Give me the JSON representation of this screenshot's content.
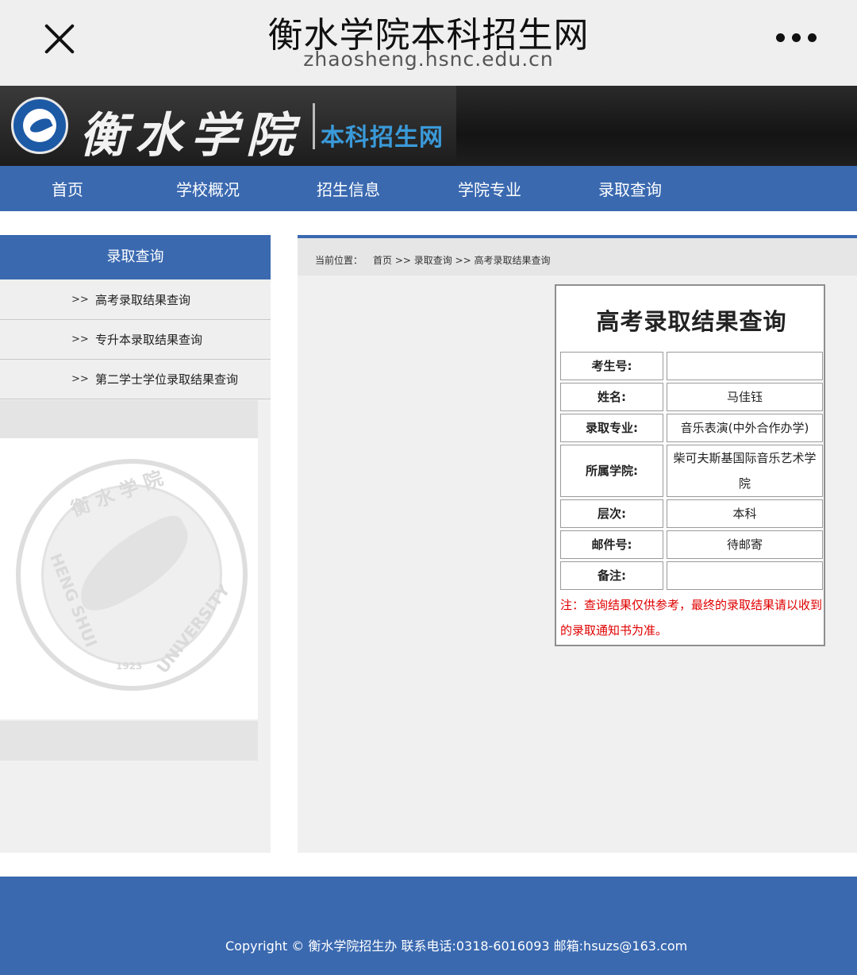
{
  "browser": {
    "title": "衡水学院本科招生网",
    "url": "zhaosheng.hsnc.edu.cn"
  },
  "header": {
    "school_name": "衡水学院",
    "subtitle": "本科招生网"
  },
  "nav": {
    "items": [
      "首页",
      "学校概况",
      "招生信息",
      "学院专业",
      "录取查询"
    ]
  },
  "sidebar": {
    "title": "录取查询",
    "arrow": ">>",
    "items": [
      "高考录取结果查询",
      "专升本录取结果查询",
      "第二学士学位录取结果查询"
    ],
    "watermark": {
      "cn": "衡 水 学 院",
      "en_left": "HENG SHUI",
      "year": "1923",
      "en_right": "UNIVERSITY"
    }
  },
  "breadcrumb": {
    "label": "当前位置：",
    "path": "首页 >> 录取查询 >> 高考录取结果查询"
  },
  "result": {
    "title": "高考录取结果查询",
    "rows": [
      {
        "label": "考生号:",
        "value": ""
      },
      {
        "label": "姓名:",
        "value": "马佳钰"
      },
      {
        "label": "录取专业:",
        "value": "音乐表演(中外合作办学)"
      },
      {
        "label": "所属学院:",
        "value": "柴可夫斯基国际音乐艺术学院"
      },
      {
        "label": "层次:",
        "value": "本科"
      },
      {
        "label": "邮件号:",
        "value": "待邮寄"
      },
      {
        "label": "备注:",
        "value": ""
      }
    ],
    "note": "注：查询结果仅供参考，最终的录取结果请以收到的录取通知书为准。"
  },
  "footer": {
    "text": "Copyright © 衡水学院招生办 联系电话:0318-6016093 邮箱:hsuzs@163.com"
  },
  "colors": {
    "nav_blue": "#3a69b0",
    "header_dark": "#1c1c1c",
    "note_red": "#e00000"
  },
  "icons": [
    "close-icon",
    "more-icon",
    "university-logo"
  ]
}
